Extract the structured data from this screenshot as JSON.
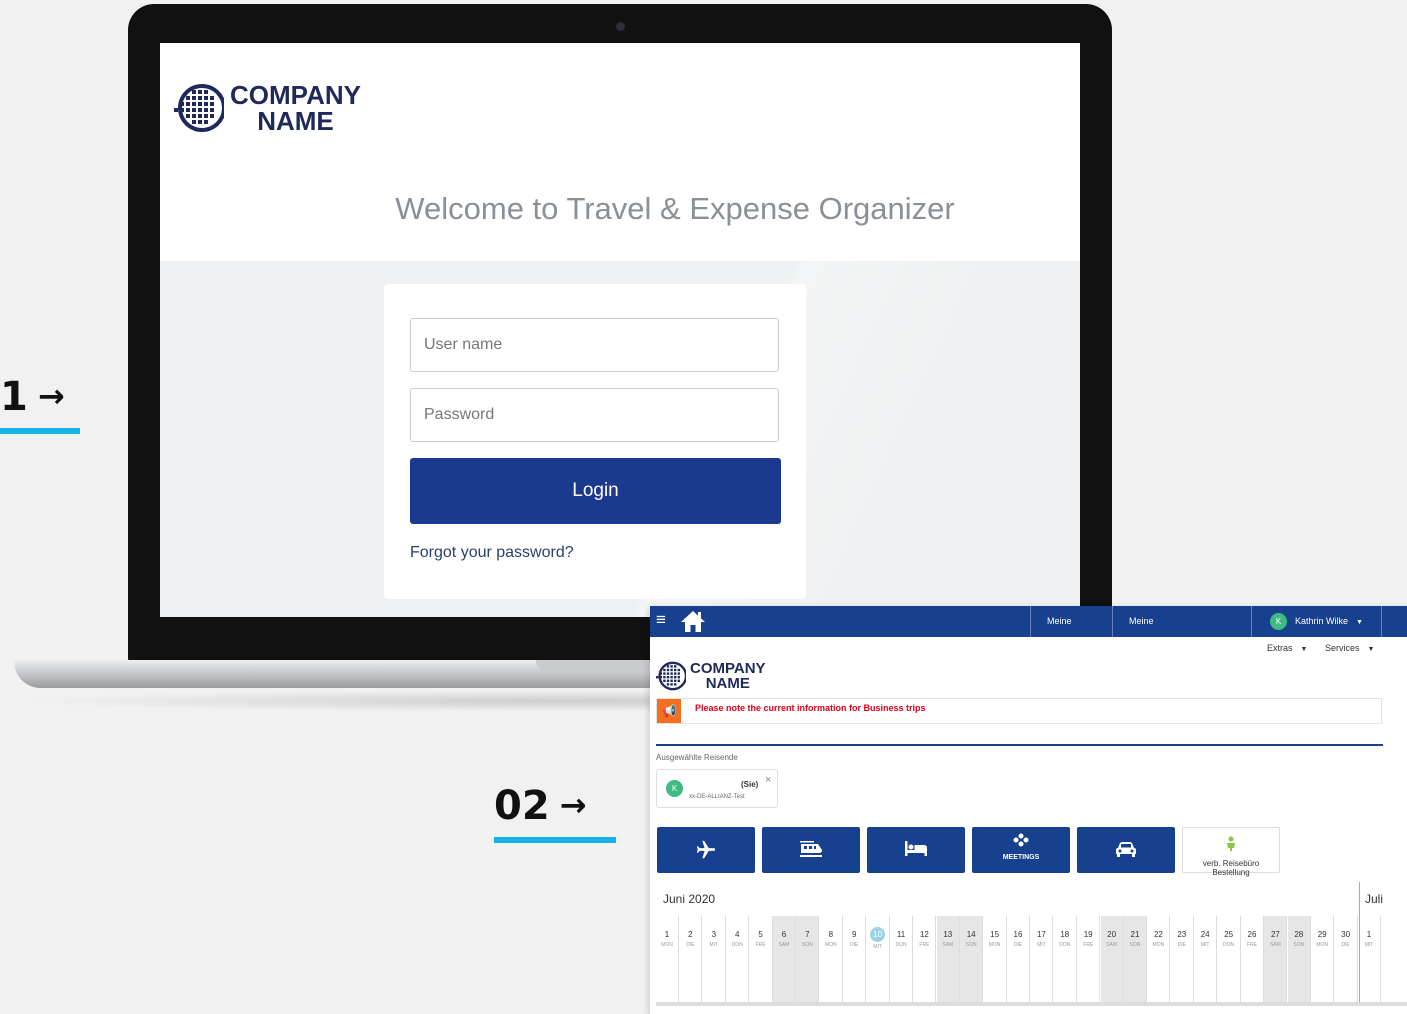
{
  "login_screen": {
    "logo": {
      "line1": "COMPANY",
      "line2": "NAME"
    },
    "welcome_title": "Welcome to Travel & Expense Organizer",
    "username_placeholder": "User name",
    "password_placeholder": "Password",
    "login_label": "Login",
    "forgot_label": "Forgot your password?"
  },
  "steps": {
    "step1": {
      "label": "1",
      "arrow": "→"
    },
    "step2": {
      "label": "02",
      "arrow": "→"
    }
  },
  "app_screen": {
    "nav": {
      "menu_icon": "hamburger-icon",
      "home_icon": "home-icon",
      "meine_reisen": "Meine Reisen",
      "kostenabrechnungen": "Meine Kostenabrechnungen",
      "user_initial": "K",
      "user_name": "Kathrin Wilke"
    },
    "subnav": {
      "extras": "Extras",
      "services": "Services"
    },
    "logo": {
      "line1": "COMPANY",
      "line2": "NAME"
    },
    "notice": "Please note the current information for Business trips",
    "traveler_label": "Ausgewählte Reisende",
    "traveler": {
      "initial": "K",
      "self_label": "(Sie)",
      "name": "xx-DE-ALLIANZ-Test",
      "close": "×"
    },
    "tiles": [
      {
        "icon": "plane-icon",
        "label": ""
      },
      {
        "icon": "train-icon",
        "label": ""
      },
      {
        "icon": "hotel-bed-icon",
        "label": ""
      },
      {
        "icon": "meetings-icon",
        "label": "MEETINGS"
      },
      {
        "icon": "car-icon",
        "label": ""
      },
      {
        "icon": "travel-agency-icon",
        "label": "verb. Reisebüro Bestellung"
      }
    ],
    "calendar": {
      "month": "Juni 2020",
      "next_month": "Juli",
      "days": [
        {
          "d": "1",
          "w": "MON"
        },
        {
          "d": "2",
          "w": "DIE"
        },
        {
          "d": "3",
          "w": "MIT"
        },
        {
          "d": "4",
          "w": "DON"
        },
        {
          "d": "5",
          "w": "FRE"
        },
        {
          "d": "6",
          "w": "SAM"
        },
        {
          "d": "7",
          "w": "SON"
        },
        {
          "d": "8",
          "w": "MON"
        },
        {
          "d": "9",
          "w": "DIE"
        },
        {
          "d": "10",
          "w": "MIT"
        },
        {
          "d": "11",
          "w": "DON"
        },
        {
          "d": "12",
          "w": "FRE"
        },
        {
          "d": "13",
          "w": "SAM"
        },
        {
          "d": "14",
          "w": "SON"
        },
        {
          "d": "15",
          "w": "MON"
        },
        {
          "d": "16",
          "w": "DIE"
        },
        {
          "d": "17",
          "w": "MIT"
        },
        {
          "d": "18",
          "w": "DON"
        },
        {
          "d": "19",
          "w": "FRE"
        },
        {
          "d": "20",
          "w": "SAM"
        },
        {
          "d": "21",
          "w": "SON"
        },
        {
          "d": "22",
          "w": "MON"
        },
        {
          "d": "23",
          "w": "DIE"
        },
        {
          "d": "24",
          "w": "MIT"
        },
        {
          "d": "25",
          "w": "DON"
        },
        {
          "d": "26",
          "w": "FRE"
        },
        {
          "d": "27",
          "w": "SAM"
        },
        {
          "d": "28",
          "w": "SON"
        },
        {
          "d": "29",
          "w": "MON"
        },
        {
          "d": "30",
          "w": "DIE"
        },
        {
          "d": "1",
          "w": "MIT"
        }
      ],
      "today": "10"
    }
  },
  "colors": {
    "brand_blue": "#1b3a8f",
    "nav_blue": "#17408f",
    "accent_cyan": "#17b3e6",
    "notice_orange": "#f36f21",
    "notice_red": "#e0001b",
    "avatar_green": "#3dbb82"
  }
}
